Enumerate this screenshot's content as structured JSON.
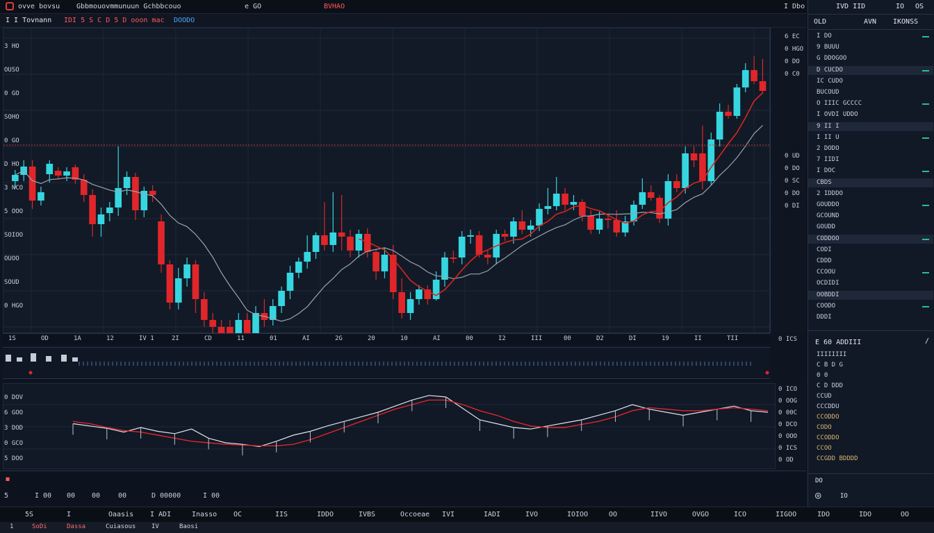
{
  "topbar": {
    "items": [
      "ovve bovsu",
      "Gbbmouovmmunuun Gchbbcouo",
      "e GO",
      "BVHAO"
    ],
    "right_label": "I Dbo"
  },
  "toolbar2": {
    "items": [
      "I I Tovnann",
      "IDI 5 S C D 5 D ooon mac",
      "DOODO"
    ]
  },
  "price_axis": {
    "labels": [
      "6 EC",
      "0 HGO",
      "0 DO",
      "0 C0",
      "0 UD",
      "0 DO",
      "0 SC",
      "0 DO",
      "0 DI"
    ],
    "bottom_label": "0 ICS"
  },
  "left_scale": {
    "labels": [
      "3 HO",
      "OUSO",
      "0 GO",
      "SOHO",
      "0 GO",
      "D HO",
      "3 NCO",
      "5 OOO",
      "SOIOO",
      "OUOO",
      "SOUD",
      "0 HGO"
    ]
  },
  "time_axis": {
    "labels": [
      "1S",
      "OD",
      "1A",
      "12",
      "IV 1",
      "2I",
      "CD",
      "11",
      "01",
      "AI",
      "2G",
      "20",
      "10",
      "AI",
      "00",
      "I2",
      "III",
      "00",
      "D2",
      "DI",
      "19",
      "II",
      "TII"
    ]
  },
  "osc_axis": {
    "labels": [
      "0 ICO",
      "0 OOG",
      "0 00C",
      "0 DCO",
      "0 OOO",
      "0 ICS",
      "0 OD"
    ]
  },
  "osc_left_scale": {
    "labels": [
      "0 DOV",
      "6 GOO",
      "3 DOD",
      "0 GCO",
      "5 DOO"
    ]
  },
  "bottom_info": {
    "items": [
      "I 00",
      "00",
      "00",
      "00",
      "D 00000",
      "I 00"
    ],
    "left_tag": "5"
  },
  "status_bar": {
    "items": [
      "5S",
      "I",
      "Oaasis",
      "I ADI",
      "Inasso",
      "OC",
      "IIS",
      "IDDO",
      "IVBS",
      "Occoeae",
      "IVI",
      "IADI",
      "IVO",
      "IOIOO",
      "OO",
      "IIVO",
      "OVGO",
      "ICO",
      "IIGOO",
      "IDO",
      "IDO",
      "OO"
    ]
  },
  "tabs_bar": {
    "items": [
      "1",
      "SoDi",
      "Dassa",
      "Cuiasous",
      "IV",
      "Baosi"
    ]
  },
  "sidebar": {
    "header": [
      "OLD",
      "AVN",
      "IKONSS"
    ],
    "top_icons": [
      "IVD IID",
      "IO",
      "OS"
    ],
    "watchlist": [
      "I DO",
      "9 BUUU",
      "G DDOGOO",
      "D CUCDO",
      "IC CUDO",
      "BUCOUD",
      "O IIIC GCCCC",
      "I OVDI UDDO",
      "9 II I",
      "I II U",
      "2 DODO",
      "7 IIDI",
      "I DOC",
      "CBDS",
      "2 IDDDO",
      "GOUDDO",
      "GCOUND",
      "GOUDD",
      "CODDOO",
      "CODI",
      "CDDD",
      "CCOOU",
      "OCDIDI",
      "OOBDDI",
      "COODO",
      "DDDI"
    ],
    "panel2_header": "E 60  ADDIII",
    "panel2_rows": [
      "IIIIIIII",
      "C B D G",
      "0 0",
      "C D DDD",
      "CCUD",
      "CCCDDU",
      "CCODDO",
      "CODO",
      "CCODDO",
      "CCOO",
      "CCGDD BDDDD"
    ],
    "panel2_footer": "DO",
    "bottom_icons": [
      "IO"
    ]
  },
  "chart_data": {
    "type": "candlestick",
    "candles": [
      [
        220,
        211,
        230,
        204
      ],
      [
        211,
        199,
        220,
        190
      ],
      [
        199,
        248,
        260,
        190
      ],
      [
        248,
        236,
        255,
        228
      ],
      [
        210,
        195,
        222,
        190
      ],
      [
        205,
        212,
        218,
        200
      ],
      [
        212,
        206,
        220,
        200
      ],
      [
        200,
        218,
        224,
        196
      ],
      [
        218,
        240,
        250,
        210
      ],
      [
        240,
        282,
        300,
        232
      ],
      [
        282,
        268,
        300,
        258
      ],
      [
        266,
        258,
        278,
        250
      ],
      [
        258,
        230,
        270,
        170
      ],
      [
        230,
        214,
        240,
        206
      ],
      [
        214,
        262,
        276,
        208
      ],
      [
        262,
        234,
        272,
        228
      ],
      [
        234,
        240,
        250,
        226
      ],
      [
        278,
        340,
        352,
        268
      ],
      [
        340,
        395,
        405,
        334
      ],
      [
        395,
        360,
        405,
        345
      ],
      [
        360,
        340,
        372,
        330
      ],
      [
        340,
        390,
        410,
        334
      ],
      [
        390,
        420,
        430,
        380
      ],
      [
        420,
        430,
        440,
        410
      ],
      [
        430,
        460,
        470,
        420
      ],
      [
        430,
        472,
        480,
        420
      ],
      [
        472,
        420,
        476,
        410
      ],
      [
        420,
        440,
        450,
        410
      ],
      [
        440,
        410,
        448,
        400
      ],
      [
        410,
        420,
        430,
        390
      ],
      [
        420,
        400,
        428,
        390
      ],
      [
        400,
        378,
        410,
        372
      ],
      [
        378,
        352,
        390,
        342
      ],
      [
        352,
        336,
        360,
        330
      ],
      [
        336,
        322,
        346,
        298
      ],
      [
        322,
        298,
        332,
        294
      ],
      [
        298,
        312,
        320,
        250
      ],
      [
        312,
        294,
        322,
        236
      ],
      [
        294,
        300,
        320,
        240
      ],
      [
        300,
        320,
        330,
        290
      ],
      [
        320,
        296,
        330,
        290
      ],
      [
        296,
        322,
        330,
        288
      ],
      [
        322,
        350,
        362,
        318
      ],
      [
        350,
        326,
        360,
        316
      ],
      [
        326,
        380,
        390,
        312
      ],
      [
        380,
        410,
        418,
        360
      ],
      [
        410,
        390,
        420,
        380
      ],
      [
        390,
        376,
        398,
        370
      ],
      [
        376,
        390,
        398,
        370
      ],
      [
        390,
        362,
        392,
        350
      ],
      [
        362,
        330,
        372,
        322
      ],
      [
        330,
        330,
        338,
        320
      ],
      [
        330,
        300,
        340,
        292
      ],
      [
        300,
        298,
        310,
        290
      ],
      [
        298,
        326,
        330,
        292
      ],
      [
        326,
        330,
        340,
        320
      ],
      [
        330,
        296,
        340,
        290
      ],
      [
        296,
        300,
        306,
        290
      ],
      [
        300,
        278,
        310,
        272
      ],
      [
        278,
        290,
        296,
        262
      ],
      [
        290,
        284,
        300,
        276
      ],
      [
        284,
        260,
        292,
        252
      ],
      [
        260,
        256,
        268,
        230
      ],
      [
        256,
        238,
        262,
        214
      ],
      [
        238,
        254,
        262,
        230
      ],
      [
        254,
        250,
        262,
        240
      ],
      [
        250,
        270,
        278,
        246
      ],
      [
        270,
        290,
        296,
        262
      ],
      [
        290,
        274,
        296,
        264
      ],
      [
        274,
        276,
        288,
        268
      ],
      [
        276,
        294,
        300,
        262
      ],
      [
        294,
        278,
        300,
        270
      ],
      [
        278,
        254,
        284,
        248
      ],
      [
        254,
        236,
        260,
        216
      ],
      [
        236,
        244,
        248,
        226
      ],
      [
        244,
        274,
        280,
        240
      ],
      [
        274,
        220,
        284,
        210
      ],
      [
        220,
        230,
        236,
        210
      ],
      [
        230,
        180,
        238,
        170
      ],
      [
        180,
        190,
        200,
        170
      ],
      [
        180,
        220,
        232,
        140
      ],
      [
        220,
        160,
        226,
        150
      ],
      [
        160,
        120,
        170,
        108
      ],
      [
        120,
        126,
        130,
        110
      ],
      [
        126,
        85,
        130,
        80
      ],
      [
        85,
        60,
        92,
        50
      ],
      [
        60,
        76,
        80,
        40
      ],
      [
        76,
        90,
        94,
        44
      ]
    ],
    "osc_series": [
      {
        "name": "",
        "values": [
          0.55,
          0.52,
          0.49,
          0.44,
          0.5,
          0.45,
          0.42,
          0.48,
          0.36,
          0.3,
          0.28,
          0.25,
          0.32,
          0.4,
          0.45,
          0.52,
          0.58,
          0.64,
          0.7,
          0.78,
          0.86,
          0.92,
          0.9,
          0.75,
          0.6,
          0.55,
          0.5,
          0.48,
          0.52,
          0.56,
          0.6,
          0.66,
          0.72,
          0.8,
          0.74,
          0.7,
          0.66,
          0.7,
          0.74,
          0.78,
          0.72,
          0.7
        ]
      },
      {
        "name": "",
        "values": [
          0.58,
          0.55,
          0.5,
          0.46,
          0.44,
          0.4,
          0.36,
          0.32,
          0.3,
          0.28,
          0.27,
          0.26,
          0.26,
          0.28,
          0.34,
          0.42,
          0.5,
          0.58,
          0.66,
          0.74,
          0.8,
          0.86,
          0.86,
          0.8,
          0.72,
          0.66,
          0.58,
          0.52,
          0.5,
          0.5,
          0.54,
          0.58,
          0.64,
          0.72,
          0.76,
          0.74,
          0.72,
          0.72,
          0.74,
          0.76,
          0.74,
          0.72
        ]
      }
    ]
  },
  "colors": {
    "bull": "#36d6e0",
    "bear": "#e0262a",
    "ma": "#d9261f",
    "ma2": "#9aa4b2"
  }
}
